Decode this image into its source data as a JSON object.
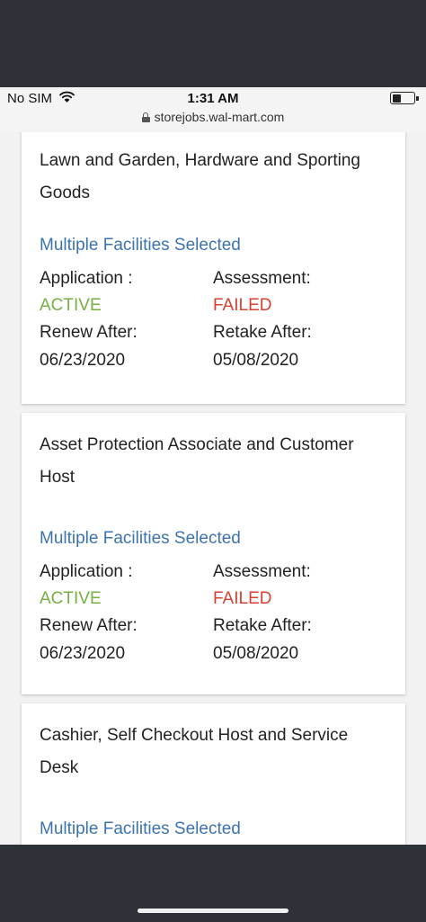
{
  "status_bar": {
    "carrier": "No SIM",
    "time": "1:31 AM",
    "url": "storejobs.wal-mart.com"
  },
  "colors": {
    "link": "#3d73ae",
    "active": "#76b043",
    "failed": "#d8412f"
  },
  "cards": [
    {
      "title": "Lawn and Garden, Hardware and Sporting Goods",
      "facilities": "Multiple Facilities Selected",
      "application_label": "Application :",
      "application_status": "ACTIVE",
      "assessment_label": "Assessment:",
      "assessment_status": "FAILED",
      "renew_label": "Renew After:",
      "renew_date": "06/23/2020",
      "retake_label": "Retake After:",
      "retake_date": "05/08/2020"
    },
    {
      "title": "Asset Protection Associate and Customer Host",
      "facilities": "Multiple Facilities Selected",
      "application_label": "Application :",
      "application_status": "ACTIVE",
      "assessment_label": "Assessment:",
      "assessment_status": "FAILED",
      "renew_label": "Renew After:",
      "renew_date": "06/23/2020",
      "retake_label": "Retake After:",
      "retake_date": "05/08/2020"
    },
    {
      "title": "Cashier, Self Checkout Host and Service Desk",
      "facilities": "Multiple Facilities Selected"
    }
  ]
}
